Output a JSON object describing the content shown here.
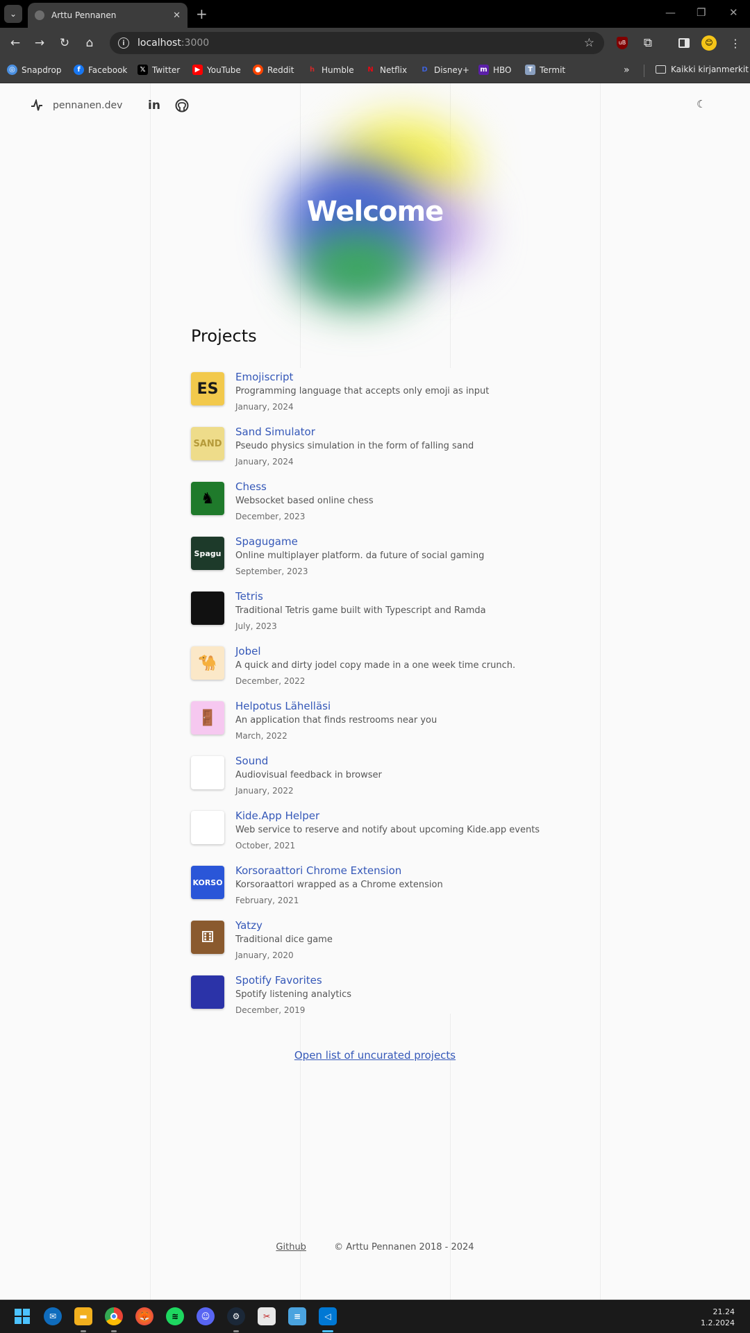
{
  "browser": {
    "tab_title": "Arttu Pennanen",
    "url_host": "localhost",
    "url_port": ":3000",
    "bookmarks": [
      {
        "label": "Snapdrop",
        "icon": "snapdrop-icon",
        "color": "#4a8fe0"
      },
      {
        "label": "Facebook",
        "icon": "facebook-icon",
        "color": "#1877f2"
      },
      {
        "label": "Twitter",
        "icon": "x-icon",
        "color": "#000000"
      },
      {
        "label": "YouTube",
        "icon": "youtube-icon",
        "color": "#ff0000"
      },
      {
        "label": "Reddit",
        "icon": "reddit-icon",
        "color": "#ff4500"
      },
      {
        "label": "Humble",
        "icon": "humble-icon",
        "color": "#cc2929"
      },
      {
        "label": "Netflix",
        "icon": "netflix-icon",
        "color": "#e50914"
      },
      {
        "label": "Disney+",
        "icon": "disney-icon",
        "color": "#1f3fb0"
      },
      {
        "label": "HBO",
        "icon": "hbo-icon",
        "color": "#5b1fa8"
      },
      {
        "label": "Termit",
        "icon": "termit-icon",
        "color": "#8aa0c0"
      }
    ],
    "bookmarks_folder": "Kaikki kirjanmerkit"
  },
  "site": {
    "logo_text": "pennanen.dev",
    "hero_title": "Welcome",
    "projects_title": "Projects",
    "projects": [
      {
        "name": "Emojiscript",
        "desc": "Programming language that accepts only emoji as input",
        "date": "January, 2024",
        "thumb": "ES",
        "thumb_bg": "#f2c94c",
        "thumb_fg": "#1a1a1a"
      },
      {
        "name": "Sand Simulator",
        "desc": "Pseudo physics simulation in the form of falling sand",
        "date": "January, 2024",
        "thumb": "SAND",
        "thumb_bg": "#eedc8a",
        "thumb_fg": "#b59a3a"
      },
      {
        "name": "Chess",
        "desc": "Websocket based online chess",
        "date": "December, 2023",
        "thumb": "♞",
        "thumb_bg": "#1f7a2b",
        "thumb_fg": "#000000"
      },
      {
        "name": "Spagugame",
        "desc": "Online multiplayer platform. da future of social gaming",
        "date": "September, 2023",
        "thumb": "Spagu",
        "thumb_bg": "#1d3a2a",
        "thumb_fg": "#ffffff"
      },
      {
        "name": "Tetris",
        "desc": "Traditional Tetris game built with Typescript and Ramda",
        "date": "July, 2023",
        "thumb": "",
        "thumb_bg": "#111111",
        "thumb_fg": "#ffffff"
      },
      {
        "name": "Jobel",
        "desc": "A quick and dirty jodel copy made in a one week time crunch.",
        "date": "December, 2022",
        "thumb": "🐪",
        "thumb_bg": "#fbe8c8",
        "thumb_fg": "#e05555"
      },
      {
        "name": "Helpotus Lähelläsi",
        "desc": "An application that finds restrooms near you",
        "date": "March, 2022",
        "thumb": "🚪",
        "thumb_bg": "#f6c8f0",
        "thumb_fg": "#1a7a5a"
      },
      {
        "name": "Sound",
        "desc": "Audiovisual feedback in browser",
        "date": "January, 2022",
        "thumb": "",
        "thumb_bg": "#ffffff",
        "thumb_fg": "#888888"
      },
      {
        "name": "Kide.App Helper",
        "desc": "Web service to reserve and notify about upcoming Kide.app events",
        "date": "October, 2021",
        "thumb": "",
        "thumb_bg": "#ffffff",
        "thumb_fg": "#3a50c8"
      },
      {
        "name": "Korsoraattori Chrome Extension",
        "desc": "Korsoraattori wrapped as a Chrome extension",
        "date": "February, 2021",
        "thumb": "KORSO",
        "thumb_bg": "#2a56d8",
        "thumb_fg": "#ffffff"
      },
      {
        "name": "Yatzy",
        "desc": "Traditional dice game",
        "date": "January, 2020",
        "thumb": "⚅",
        "thumb_bg": "#8a5a2e",
        "thumb_fg": "#ffffff"
      },
      {
        "name": "Spotify Favorites",
        "desc": "Spotify listening analytics",
        "date": "December, 2019",
        "thumb": "",
        "thumb_bg": "#2b33a8",
        "thumb_fg": "#ffffff"
      }
    ],
    "uncurated_link": "Open list of uncurated projects",
    "footer_github": "Github",
    "footer_copyright": "© Arttu Pennanen 2018 - 2024"
  },
  "taskbar": {
    "time": "21.24",
    "date": "1.2.2024",
    "apps": [
      "start-icon",
      "outlook-icon",
      "file-explorer-icon",
      "chrome-icon",
      "firefox-icon",
      "spotify-icon",
      "discord-icon",
      "steam-icon",
      "snipping-tool-icon",
      "notepad-icon",
      "vscode-icon"
    ]
  },
  "colors": {
    "accent_link": "#3558b8",
    "page_bg": "#fafafa",
    "chrome_dark": "#3c3c3c"
  }
}
